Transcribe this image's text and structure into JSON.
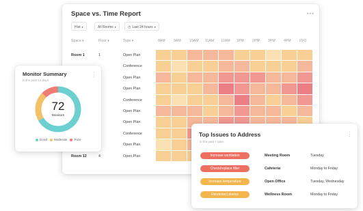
{
  "report": {
    "title": "Space vs. Time Report",
    "filters": [
      {
        "label": "Hist"
      },
      {
        "label": "All Rooms"
      },
      {
        "label": "Last 24 hours"
      }
    ],
    "columns": {
      "space": "Space",
      "floor": "Floor",
      "type": "Type"
    },
    "times": [
      "8AM",
      "9AM",
      "10AM",
      "11AM",
      "12AM",
      "1PM",
      "2PM",
      "3PM",
      "4PM",
      "6VO"
    ],
    "rows": [
      {
        "space": "Room 1",
        "floor": "1",
        "type": "Open Plan"
      },
      {
        "space": "",
        "floor": "",
        "type": "Conference"
      },
      {
        "space": "",
        "floor": "",
        "type": "Open Plan"
      },
      {
        "space": "",
        "floor": "",
        "type": "Open Plan"
      },
      {
        "space": "",
        "floor": "",
        "type": "Conference"
      },
      {
        "space": "",
        "floor": "",
        "type": "Open Plan"
      },
      {
        "space": "",
        "floor": "",
        "type": "Open Plan"
      },
      {
        "space": "",
        "floor": "",
        "type": "Conference"
      },
      {
        "space": "",
        "floor": "",
        "type": "Open Plan"
      },
      {
        "space": "Room 12",
        "floor": "4",
        "type": "Open Plan"
      }
    ],
    "heat_levels": [
      [
        1,
        1,
        2,
        2,
        2,
        1,
        1,
        0,
        1,
        1
      ],
      [
        1,
        0,
        1,
        1,
        2,
        2,
        1,
        1,
        1,
        2
      ],
      [
        2,
        1,
        2,
        2,
        3,
        3,
        3,
        2,
        2,
        3
      ],
      [
        1,
        1,
        1,
        2,
        4,
        3,
        2,
        2,
        3,
        4
      ],
      [
        1,
        0,
        1,
        1,
        2,
        4,
        2,
        1,
        2,
        3
      ],
      [
        2,
        2,
        2,
        1,
        2,
        3,
        2,
        2,
        1,
        2
      ],
      [
        1,
        1,
        2,
        2,
        3,
        3,
        2,
        2,
        2,
        1
      ],
      [
        1,
        1,
        3,
        4,
        4,
        4,
        3,
        2,
        1,
        1
      ],
      [
        0,
        1,
        2,
        3,
        3,
        2,
        2,
        1,
        1,
        2
      ],
      [
        1,
        1,
        1,
        2,
        2,
        2,
        1,
        1,
        1,
        1
      ]
    ],
    "heat_colors": [
      "#fbe0b4",
      "#f8cf94",
      "#f6b89a",
      "#f19892",
      "#ec7f86"
    ]
  },
  "monitor": {
    "title": "Monitor Summary",
    "subtitle": "In the past 14 days",
    "total": "72",
    "total_label": "Monitors",
    "segments": [
      {
        "name": "Good",
        "value": 48,
        "color": "#6ccfd0"
      },
      {
        "name": "Moderate",
        "value": 15,
        "color": "#f4c16b"
      },
      {
        "name": "Poor",
        "value": 9,
        "color": "#ee7c72"
      }
    ]
  },
  "issues": {
    "title": "Top Issues to Address",
    "subtitle": "In the past 7 days",
    "items": [
      {
        "action": "Increase ventilation",
        "location": "Meeting Room",
        "days": "Tuesday",
        "color": "#ec6f62"
      },
      {
        "action": "Check/replace filter",
        "location": "Cafeteria",
        "days": "Monday to Friday",
        "color": "#ec6f62"
      },
      {
        "action": "Increase temperature",
        "location": "Open Office",
        "days": "Tuesday, Wednesday",
        "color": "#f3b64f"
      },
      {
        "action": "Reconnect device",
        "location": "Wellness Room",
        "days": "Monday to Friday",
        "color": "#f3b64f"
      }
    ]
  }
}
